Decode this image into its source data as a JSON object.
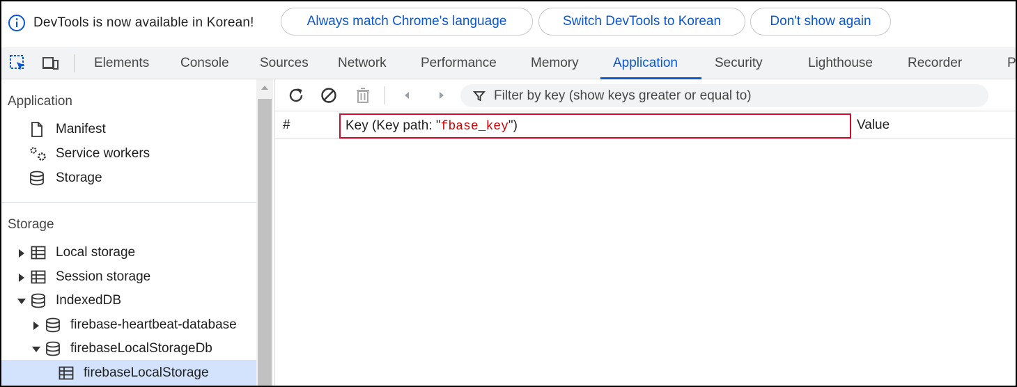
{
  "infobar": {
    "message": "DevTools is now available in Korean!",
    "buttons": {
      "match_language": "Always match Chrome's language",
      "switch_language": "Switch DevTools to Korean",
      "dont_show": "Don't show again"
    }
  },
  "tabs": [
    {
      "label": "Elements"
    },
    {
      "label": "Console"
    },
    {
      "label": "Sources"
    },
    {
      "label": "Network"
    },
    {
      "label": "Performance"
    },
    {
      "label": "Memory"
    },
    {
      "label": "Application",
      "active": true
    },
    {
      "label": "Security"
    },
    {
      "label": "Lighthouse"
    },
    {
      "label": "Recorder"
    },
    {
      "label": "P"
    }
  ],
  "sidebar": {
    "application": {
      "title": "Application",
      "items": [
        {
          "label": "Manifest",
          "icon": "document-icon"
        },
        {
          "label": "Service workers",
          "icon": "gears-icon"
        },
        {
          "label": "Storage",
          "icon": "database-icon"
        }
      ]
    },
    "storage": {
      "title": "Storage",
      "items": [
        {
          "label": "Local storage",
          "icon": "table-icon",
          "expanded": false
        },
        {
          "label": "Session storage",
          "icon": "table-icon",
          "expanded": false
        },
        {
          "label": "IndexedDB",
          "icon": "database-icon",
          "expanded": true
        },
        {
          "label": "firebase-heartbeat-database",
          "icon": "database-icon",
          "expanded": false
        },
        {
          "label": "firebaseLocalStorageDb",
          "icon": "database-icon",
          "expanded": true
        },
        {
          "label": "firebaseLocalStorage",
          "icon": "table-icon",
          "selected": true
        }
      ]
    }
  },
  "toolbar": {
    "filter_placeholder": "Filter by key (show keys greater or equal to)"
  },
  "table": {
    "columns": {
      "index": "#",
      "key_prefix": "Key (Key path: \"",
      "key_path": "fbase_key",
      "key_suffix": "\")",
      "value": "Value"
    }
  },
  "colors": {
    "accent": "#0b57d0",
    "highlight_border": "#c8102e",
    "selected_bg": "#d3e3fd",
    "key_path_text": "#c80000"
  }
}
